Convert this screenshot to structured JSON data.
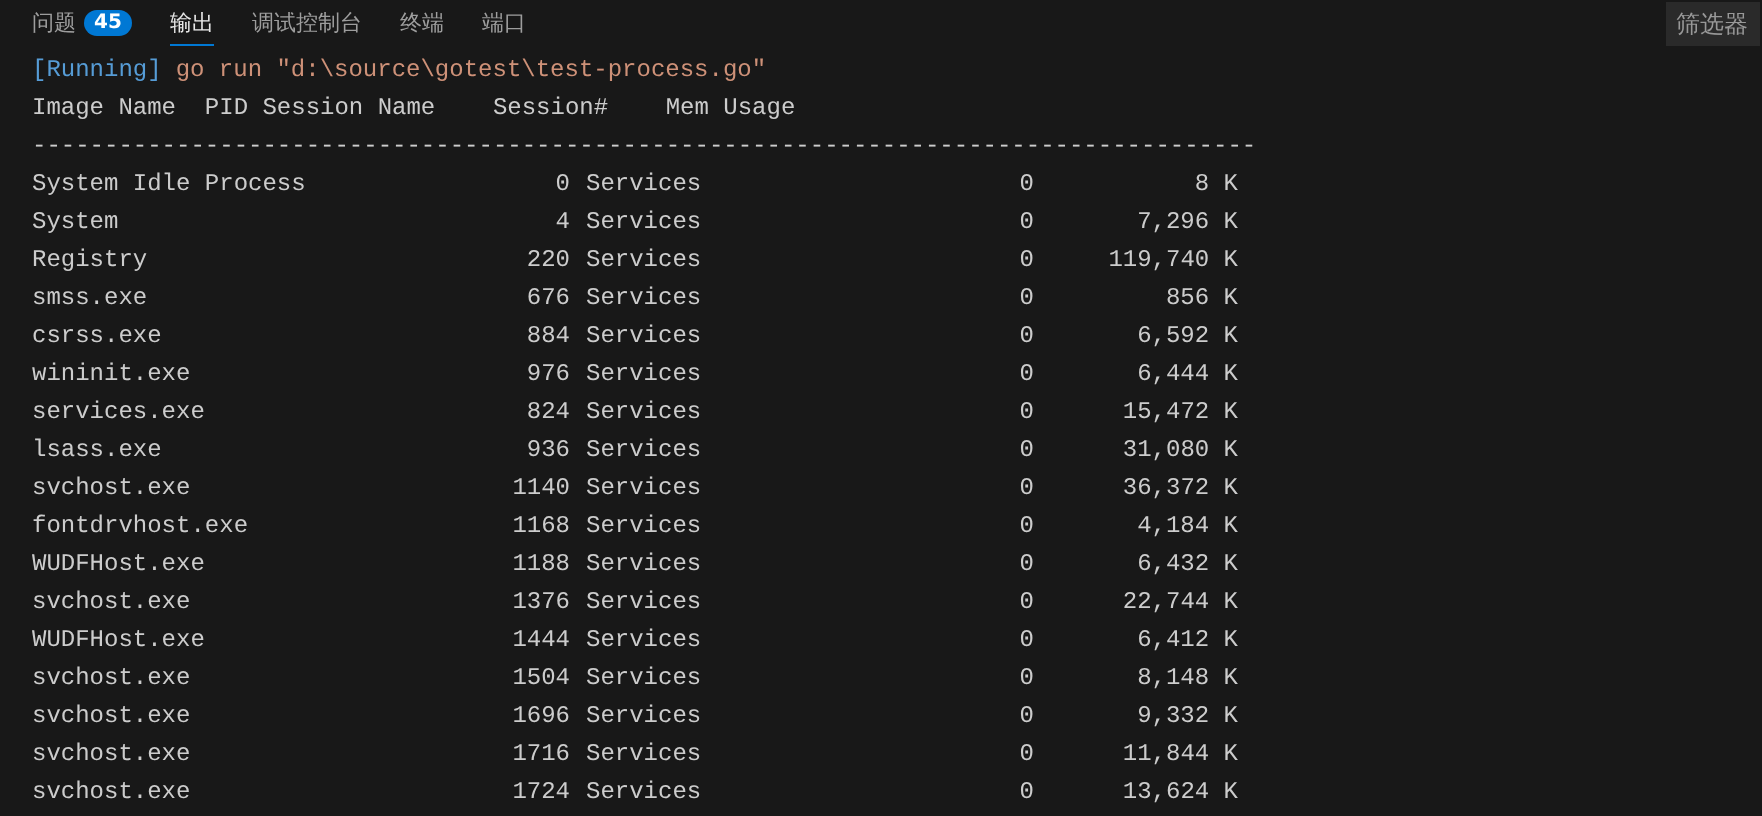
{
  "tabs": [
    {
      "label": "问题",
      "badge": "45",
      "selected": false
    },
    {
      "label": "输出",
      "selected": true
    },
    {
      "label": "调试控制台",
      "selected": false
    },
    {
      "label": "终端",
      "selected": false
    },
    {
      "label": "端口",
      "selected": false
    }
  ],
  "filter": {
    "placeholder": "筛选器"
  },
  "output": {
    "status": "[Running]",
    "command": "go run \"d:\\source\\gotest\\test-process.go\"",
    "header": "Image Name  PID Session Name    Session#    Mem Usage",
    "separator": "-------------------------------------------------------------------------------------",
    "rows": [
      {
        "name": "System Idle Process",
        "pid": "0",
        "session_name": "Services",
        "session": "0",
        "mem": "8 K"
      },
      {
        "name": "System",
        "pid": "4",
        "session_name": "Services",
        "session": "0",
        "mem": "7,296 K"
      },
      {
        "name": "Registry",
        "pid": "220",
        "session_name": "Services",
        "session": "0",
        "mem": "119,740 K"
      },
      {
        "name": "smss.exe",
        "pid": "676",
        "session_name": "Services",
        "session": "0",
        "mem": "856 K"
      },
      {
        "name": "csrss.exe",
        "pid": "884",
        "session_name": "Services",
        "session": "0",
        "mem": "6,592 K"
      },
      {
        "name": "wininit.exe",
        "pid": "976",
        "session_name": "Services",
        "session": "0",
        "mem": "6,444 K"
      },
      {
        "name": "services.exe",
        "pid": "824",
        "session_name": "Services",
        "session": "0",
        "mem": "15,472 K"
      },
      {
        "name": "lsass.exe",
        "pid": "936",
        "session_name": "Services",
        "session": "0",
        "mem": "31,080 K"
      },
      {
        "name": "svchost.exe",
        "pid": "1140",
        "session_name": "Services",
        "session": "0",
        "mem": "36,372 K"
      },
      {
        "name": "fontdrvhost.exe",
        "pid": "1168",
        "session_name": "Services",
        "session": "0",
        "mem": "4,184 K"
      },
      {
        "name": "WUDFHost.exe",
        "pid": "1188",
        "session_name": "Services",
        "session": "0",
        "mem": "6,432 K"
      },
      {
        "name": "svchost.exe",
        "pid": "1376",
        "session_name": "Services",
        "session": "0",
        "mem": "22,744 K"
      },
      {
        "name": "WUDFHost.exe",
        "pid": "1444",
        "session_name": "Services",
        "session": "0",
        "mem": "6,412 K"
      },
      {
        "name": "svchost.exe",
        "pid": "1504",
        "session_name": "Services",
        "session": "0",
        "mem": "8,148 K"
      },
      {
        "name": "svchost.exe",
        "pid": "1696",
        "session_name": "Services",
        "session": "0",
        "mem": "9,332 K"
      },
      {
        "name": "svchost.exe",
        "pid": "1716",
        "session_name": "Services",
        "session": "0",
        "mem": "11,844 K"
      },
      {
        "name": "svchost.exe",
        "pid": "1724",
        "session_name": "Services",
        "session": "0",
        "mem": "13,624 K"
      }
    ]
  }
}
